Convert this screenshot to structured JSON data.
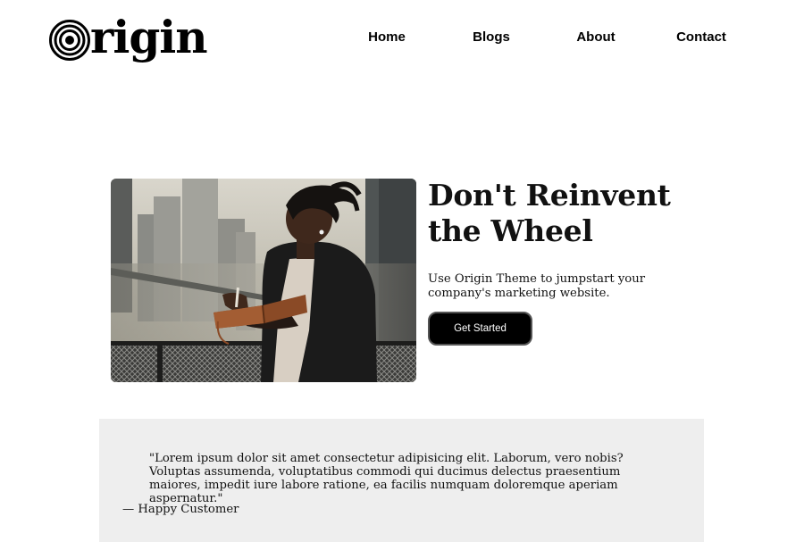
{
  "header": {
    "logo_text": "rigin",
    "logo_icon": "concentric-circles-icon",
    "nav": [
      {
        "label": "Home"
      },
      {
        "label": "Blogs"
      },
      {
        "label": "About"
      },
      {
        "label": "Contact"
      }
    ]
  },
  "hero": {
    "title_line1": "Don't Reinvent",
    "title_line2": "the Wheel",
    "subtitle": "Use Origin Theme to jumpstart your company's marketing website.",
    "cta_label": "Get Started",
    "image_subject": "photo-person-reading-notebook-city"
  },
  "testimonial": {
    "quote": "\"Lorem ipsum dolor sit amet consectetur adipisicing elit. Laborum, vero nobis? Voluptas assumenda, voluptatibus commodi qui ducimus delectus praesentium maiores, impedit iure labore ratione, ea facilis numquam doloremque aperiam aspernatur.\"",
    "author": "— Happy Customer"
  },
  "colors": {
    "text": "#000000",
    "button_bg": "#000000",
    "button_text": "#ffffff",
    "testimonial_bg": "#eeeeee",
    "page_bg": "#ffffff"
  }
}
